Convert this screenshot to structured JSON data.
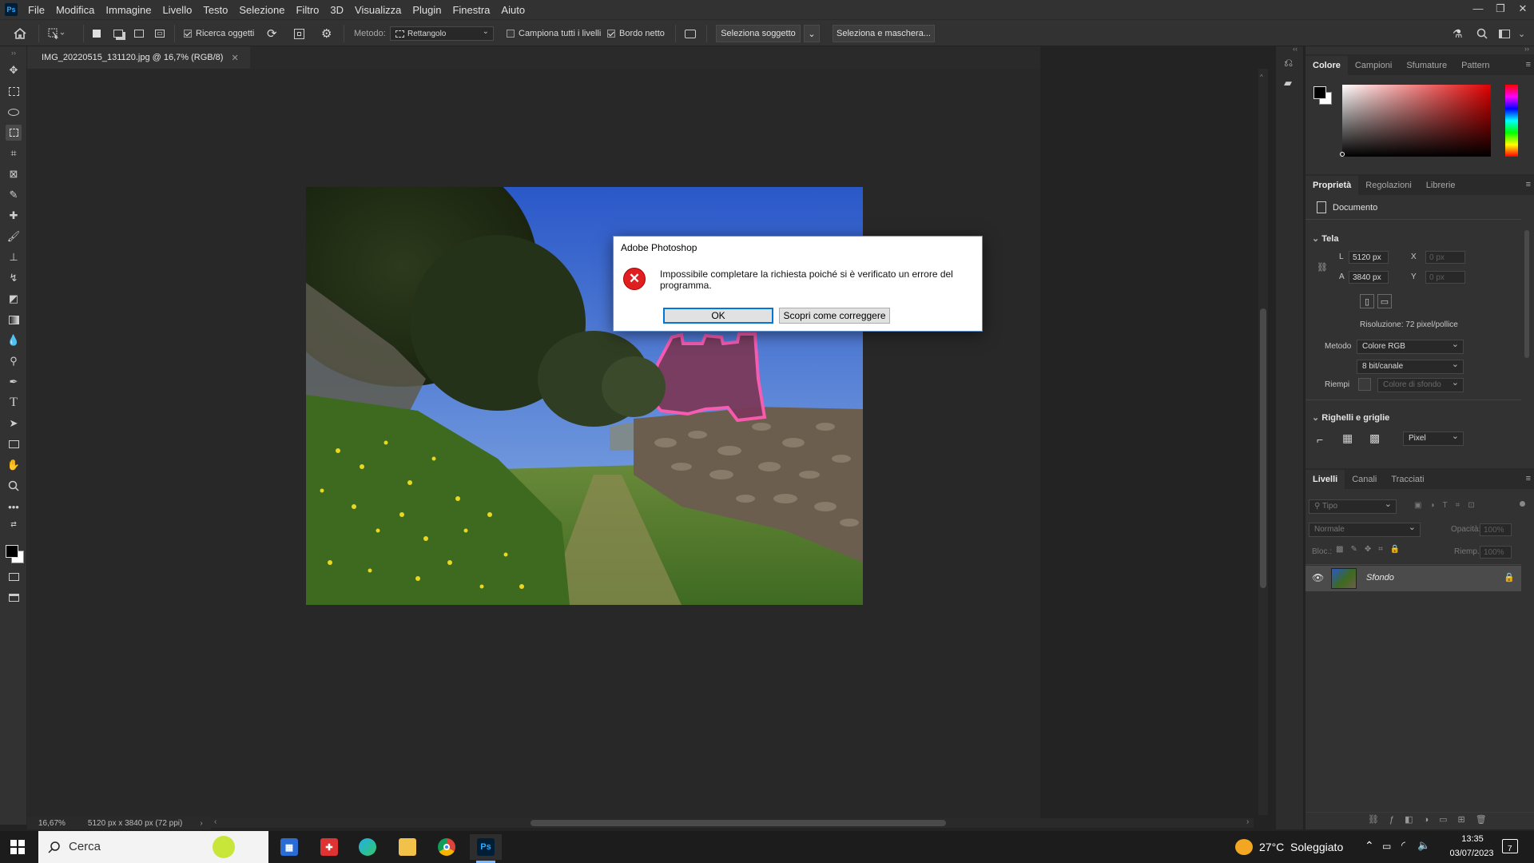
{
  "app": {
    "logo": "Ps"
  },
  "menu": [
    "File",
    "Modifica",
    "Immagine",
    "Livello",
    "Testo",
    "Selezione",
    "Filtro",
    "3D",
    "Visualizza",
    "Plugin",
    "Finestra",
    "Aiuto"
  ],
  "options": {
    "ricerca_oggetti": "Ricerca oggetti",
    "metodo_label": "Metodo:",
    "metodo_value": "Rettangolo",
    "campiona": "Campiona tutti i livelli",
    "bordo_netto": "Bordo netto",
    "seleziona_soggetto": "Seleziona soggetto",
    "seleziona_maschera": "Seleziona e maschera..."
  },
  "document": {
    "tab_title": "IMG_20220515_131120.jpg @ 16,7% (RGB/8)",
    "zoom": "16,67%",
    "info": "5120 px x 3840 px (72 ppi)"
  },
  "dialog": {
    "title": "Adobe Photoshop",
    "message": "Impossibile completare la richiesta poiché si è verificato un errore del programma.",
    "ok": "OK",
    "help": "Scopri come correggere"
  },
  "color_panel": {
    "tabs": [
      "Colore",
      "Campioni",
      "Sfumature",
      "Pattern"
    ]
  },
  "properties": {
    "tabs": [
      "Proprietà",
      "Regolazioni",
      "Librerie"
    ],
    "doc_label": "Documento",
    "tela_label": "Tela",
    "l_label": "L",
    "l_value": "5120 px",
    "a_label": "A",
    "a_value": "3840 px",
    "x_label": "X",
    "x_value": "0 px",
    "y_label": "Y",
    "y_value": "0 px",
    "risoluzione": "Risoluzione: 72 pixel/pollice",
    "metodo_label": "Metodo",
    "metodo_value": "Colore RGB",
    "bit_value": "8 bit/canale",
    "riempi_label": "Riempi",
    "riempi_value": "Colore di sfondo",
    "righelli_label": "Righelli e griglie",
    "units_value": "Pixel"
  },
  "layers": {
    "tabs": [
      "Livelli",
      "Canali",
      "Tracciati"
    ],
    "filter_placeholder": "Tipo",
    "blend_mode": "Normale",
    "opacity_label": "Opacità:",
    "opacity_value": "100%",
    "lock_label": "Bloc.:",
    "fill_label": "Riemp.:",
    "fill_value": "100%",
    "layer_name": "Sfondo"
  },
  "taskbar": {
    "search_placeholder": "Cerca",
    "weather": "27°C  Soleggiato",
    "time": "13:35",
    "date": "03/07/2023",
    "notif_count": "7"
  }
}
